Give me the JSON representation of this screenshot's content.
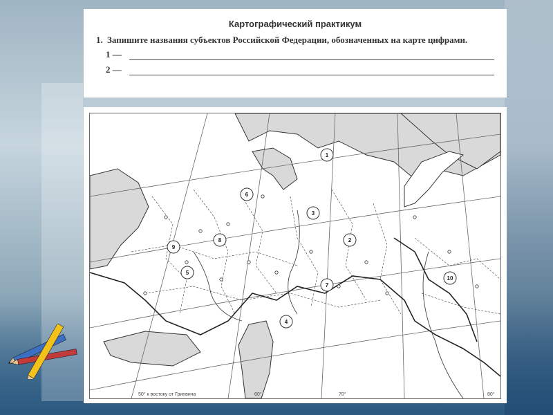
{
  "slide": {
    "heading": "Картографический практикум",
    "task_number": "1.",
    "task_text": "Запишите названия субъектов Российской Федерации, обозначенных на карте цифрами.",
    "answer_lines": [
      {
        "label": "1 —"
      },
      {
        "label": "2 —"
      }
    ]
  },
  "map": {
    "region_markers": [
      "1",
      "2",
      "3",
      "4",
      "5",
      "6",
      "7",
      "8",
      "9",
      "10"
    ],
    "bottom_labels": {
      "meridian_note": "50° к востоку от Гринвича",
      "lon_60": "60°",
      "lon_70": "70°",
      "lon_80": "80°"
    },
    "colors": {
      "land": "#ffffff",
      "sea": "#d9d9d9",
      "border": "#333333",
      "grid": "#666666"
    }
  },
  "decor": {
    "icon": "pencils-icon"
  }
}
